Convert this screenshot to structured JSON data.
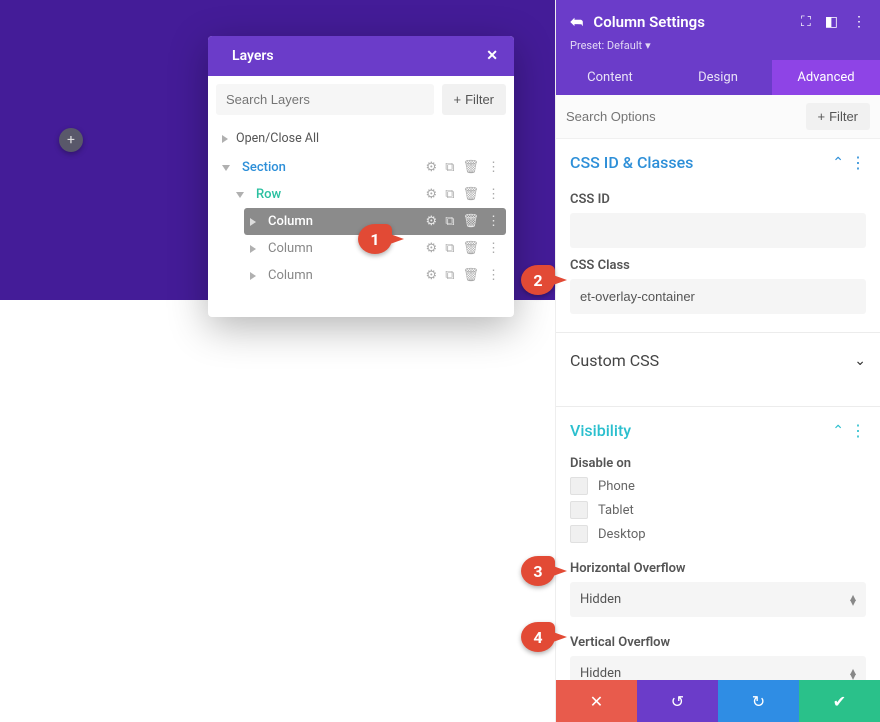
{
  "canvas": {
    "add_fab_icon": "plus-icon"
  },
  "layers": {
    "title": "Layers",
    "close_icon": "close-icon",
    "search_placeholder": "Search Layers",
    "filter_label": "Filter",
    "open_close_all": "Open/Close All",
    "rows": {
      "section": "Section",
      "row": "Row",
      "columns": [
        "Column",
        "Column",
        "Column"
      ]
    }
  },
  "settings": {
    "title": "Column Settings",
    "preset_label": "Preset: Default",
    "tabs": {
      "content": "Content",
      "design": "Design",
      "advanced": "Advanced"
    },
    "search_placeholder": "Search Options",
    "filter_label": "Filter",
    "sections": {
      "css_id_classes": {
        "title": "CSS ID & Classes",
        "css_id_label": "CSS ID",
        "css_id_value": "",
        "css_class_label": "CSS Class",
        "css_class_value": "et-overlay-container"
      },
      "custom_css": {
        "title": "Custom CSS"
      },
      "visibility": {
        "title": "Visibility",
        "disable_on_label": "Disable on",
        "options": [
          "Phone",
          "Tablet",
          "Desktop"
        ],
        "h_overflow_label": "Horizontal Overflow",
        "h_overflow_value": "Hidden",
        "v_overflow_label": "Vertical Overflow",
        "v_overflow_value": "Hidden"
      }
    },
    "footer": {
      "close": "✕",
      "undo": "↺",
      "redo": "↻",
      "save": "✔"
    }
  },
  "markers": {
    "m1": "1",
    "m2": "2",
    "m3": "3",
    "m4": "4"
  }
}
